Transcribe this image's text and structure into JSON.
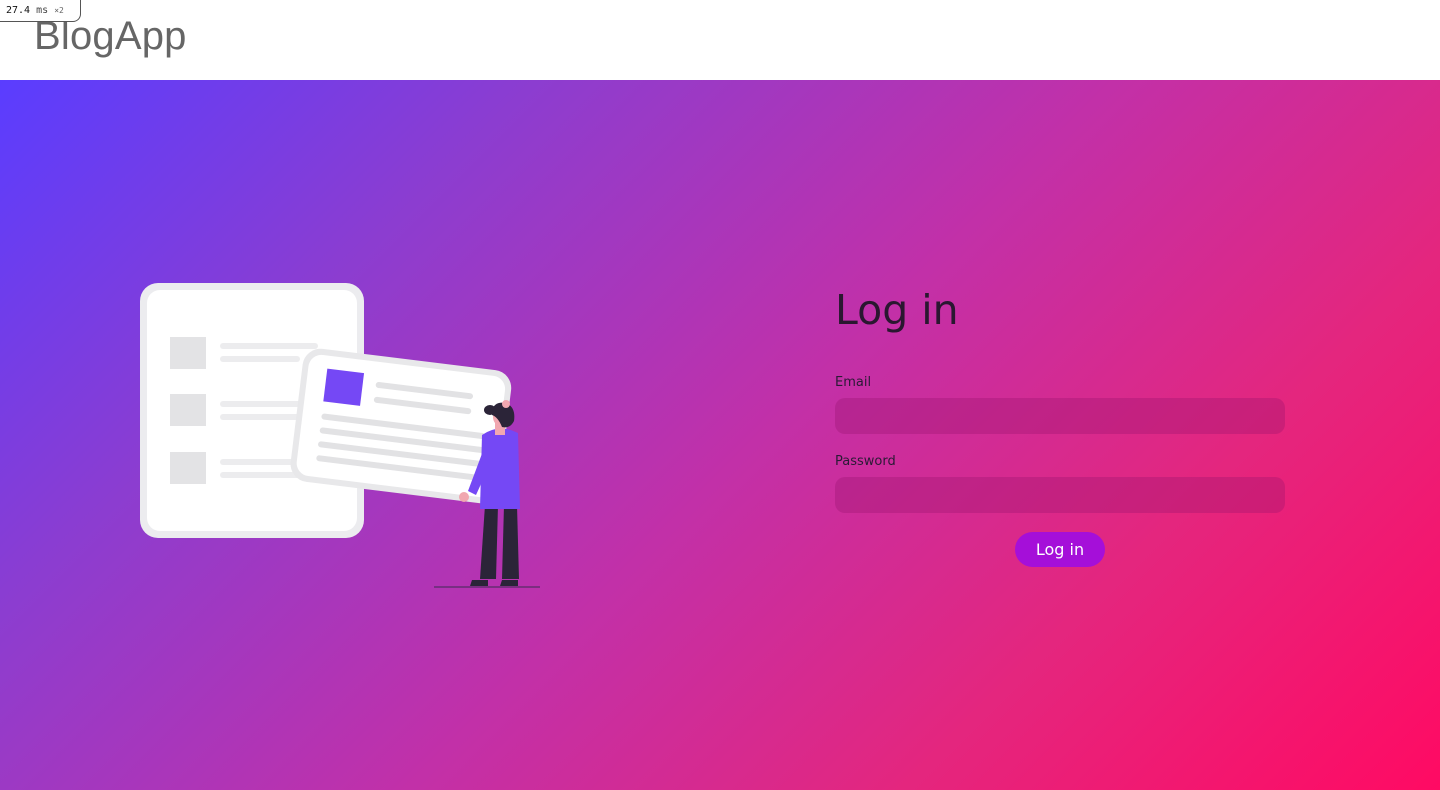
{
  "perf": {
    "value": "27.4",
    "unit": "ms",
    "multiplier": "×2"
  },
  "header": {
    "brand": "BlogApp"
  },
  "login": {
    "title": "Log in",
    "email_label": "Email",
    "email_value": "",
    "password_label": "Password",
    "password_value": "",
    "submit_label": "Log in"
  },
  "colors": {
    "gradient_start": "#5a3dff",
    "gradient_end": "#ff0a63",
    "button": "#a50fd9",
    "accent_square": "#7548f5"
  },
  "illustration": {
    "icon": "person-holding-document-illustration"
  }
}
